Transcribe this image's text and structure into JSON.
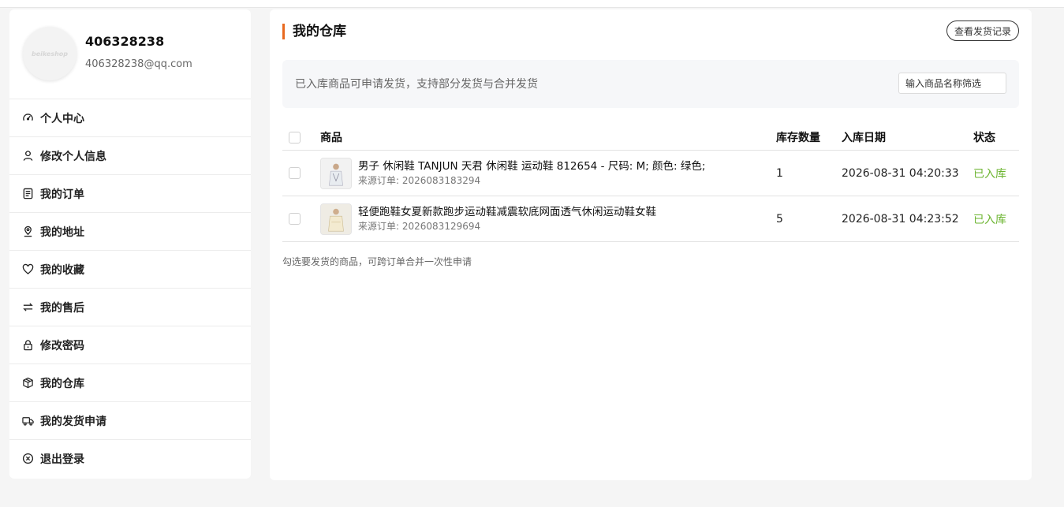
{
  "user": {
    "name": "406328238",
    "email": "406328238@qq.com",
    "avatar_text": "beikeshop"
  },
  "menu": [
    {
      "label": "个人中心",
      "icon": "dashboard-icon"
    },
    {
      "label": "修改个人信息",
      "icon": "user-icon"
    },
    {
      "label": "我的订单",
      "icon": "order-icon"
    },
    {
      "label": "我的地址",
      "icon": "location-icon"
    },
    {
      "label": "我的收藏",
      "icon": "heart-icon"
    },
    {
      "label": "我的售后",
      "icon": "exchange-icon"
    },
    {
      "label": "修改密码",
      "icon": "lock-icon"
    },
    {
      "label": "我的仓库",
      "icon": "box-icon"
    },
    {
      "label": "我的发货申请",
      "icon": "truck-icon"
    },
    {
      "label": "退出登录",
      "icon": "logout-icon"
    }
  ],
  "main": {
    "title": "我的仓库",
    "history_button": "查看发货记录",
    "info_text": "已入库商品可申请发货，支持部分发货与合并发货",
    "filter_placeholder": "输入商品名称筛选",
    "columns": [
      "商品",
      "库存数量",
      "入库日期",
      "状态"
    ],
    "rows": [
      {
        "name": "男子 休闲鞋 TANJUN 天君 休闲鞋 运动鞋 812654 - 尺码: M; 颜色: 绿色;",
        "source_label": "来源订单:",
        "source_order": "2026083183294",
        "qty": "1",
        "date": "2026-08-31 04:20:33",
        "status": "已入库"
      },
      {
        "name": "轻便跑鞋女夏新款跑步运动鞋减震软底网面透气休闲运动鞋女鞋",
        "source_label": "来源订单:",
        "source_order": "2026083129694",
        "qty": "5",
        "date": "2026-08-31 04:23:52",
        "status": "已入库"
      }
    ],
    "footnote": "勾选要发货的商品，可跨订单合并一次性申请"
  },
  "colors": {
    "accent": "#e8691f",
    "status_green": "#6bb42f"
  }
}
